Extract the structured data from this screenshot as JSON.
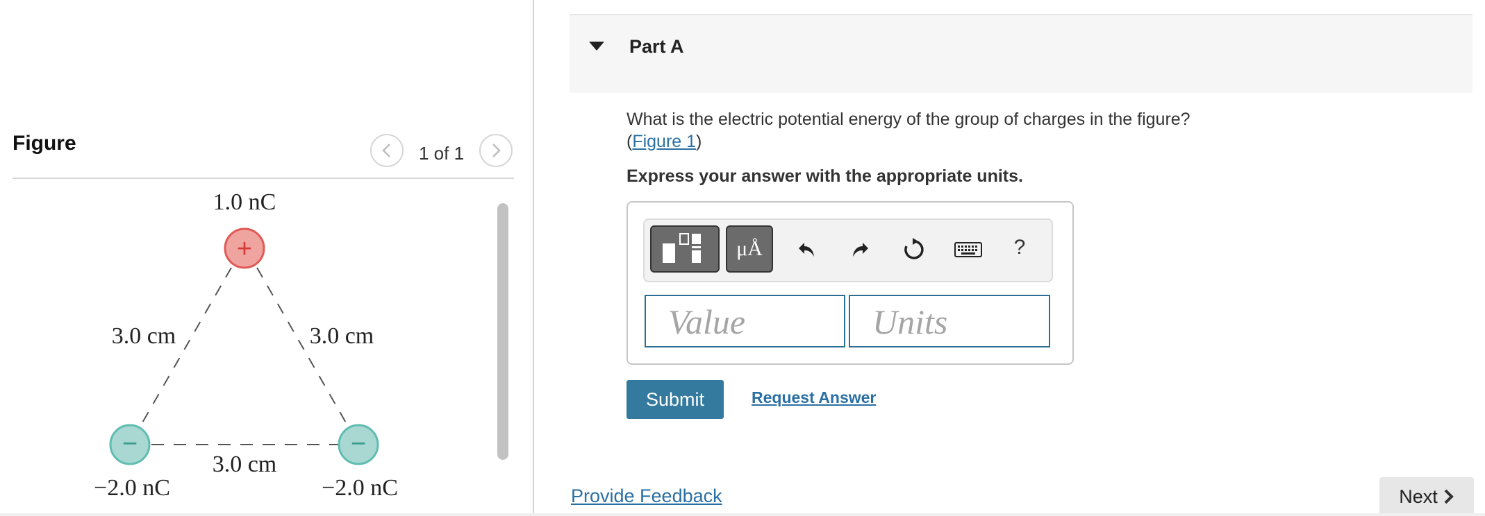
{
  "figure_panel": {
    "title": "Figure",
    "pager": "1 of 1",
    "prev_icon": "chevron-left-icon",
    "next_icon": "chevron-right-icon",
    "diagram": {
      "top_charge_label": "1.0 nC",
      "top_charge_sign": "+",
      "left_charge_label": "−2.0 nC",
      "left_charge_sign": "−",
      "right_charge_label": "−2.0 nC",
      "right_charge_sign": "−",
      "left_side_label": "3.0 cm",
      "right_side_label": "3.0 cm",
      "bottom_side_label": "3.0 cm",
      "positive_color": "#f0a4a0",
      "negative_color": "#a9d8d2"
    }
  },
  "part": {
    "title": "Part A",
    "caret_icon": "caret-down-icon",
    "question_text": "What is the electric potential energy of the group of charges in the figure?",
    "figure_link_open": "(",
    "figure_link": "Figure 1",
    "figure_link_close": ")",
    "instruction": "Express your answer with the appropriate units."
  },
  "toolbar": {
    "templates_icon": "templates-icon",
    "units_label": "μÅ",
    "undo_icon": "undo-icon",
    "redo_icon": "redo-icon",
    "reset_icon": "reset-icon",
    "keyboard_icon": "keyboard-icon",
    "help_label": "?"
  },
  "inputs": {
    "value_placeholder": "Value",
    "units_placeholder": "Units"
  },
  "actions": {
    "submit_label": "Submit",
    "request_answer_label": "Request Answer",
    "feedback_label": "Provide Feedback",
    "next_label": "Next"
  },
  "colors": {
    "accent": "#337a9e",
    "link": "#2a6fa3",
    "input_border": "#2a6f93"
  }
}
